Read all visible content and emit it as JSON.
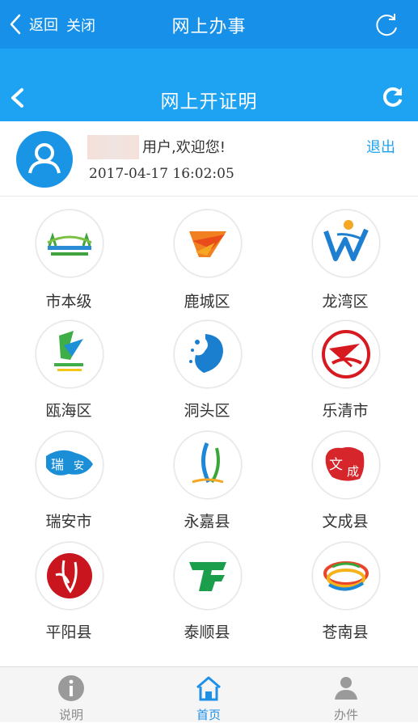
{
  "topbar": {
    "back_label": "返回",
    "close_label": "关闭",
    "title": "网上办事"
  },
  "subbar": {
    "title": "网上开证明"
  },
  "user": {
    "greeting": "用户,欢迎您!",
    "datetime": "2017-04-17 16:02:05",
    "logout_label": "退出"
  },
  "regions": [
    {
      "label": "市本级",
      "icon": "city-level-logo"
    },
    {
      "label": "鹿城区",
      "icon": "lucheng-logo"
    },
    {
      "label": "龙湾区",
      "icon": "longwan-logo"
    },
    {
      "label": "瓯海区",
      "icon": "ouhai-logo"
    },
    {
      "label": "洞头区",
      "icon": "dongtou-logo"
    },
    {
      "label": "乐清市",
      "icon": "yueqing-logo"
    },
    {
      "label": "瑞安市",
      "icon": "ruian-logo"
    },
    {
      "label": "永嘉县",
      "icon": "yongjia-logo"
    },
    {
      "label": "文成县",
      "icon": "wencheng-logo"
    },
    {
      "label": "平阳县",
      "icon": "pingyang-logo"
    },
    {
      "label": "泰顺县",
      "icon": "taishun-logo"
    },
    {
      "label": "苍南县",
      "icon": "cangnan-logo"
    }
  ],
  "tabs": [
    {
      "label": "说明",
      "icon": "info-icon"
    },
    {
      "label": "首页",
      "icon": "home-icon"
    },
    {
      "label": "办件",
      "icon": "person-icon"
    }
  ],
  "colors": {
    "primary": "#1690e8",
    "header": "#1ea2f2",
    "text": "#333333",
    "muted": "#8a8a8a"
  }
}
